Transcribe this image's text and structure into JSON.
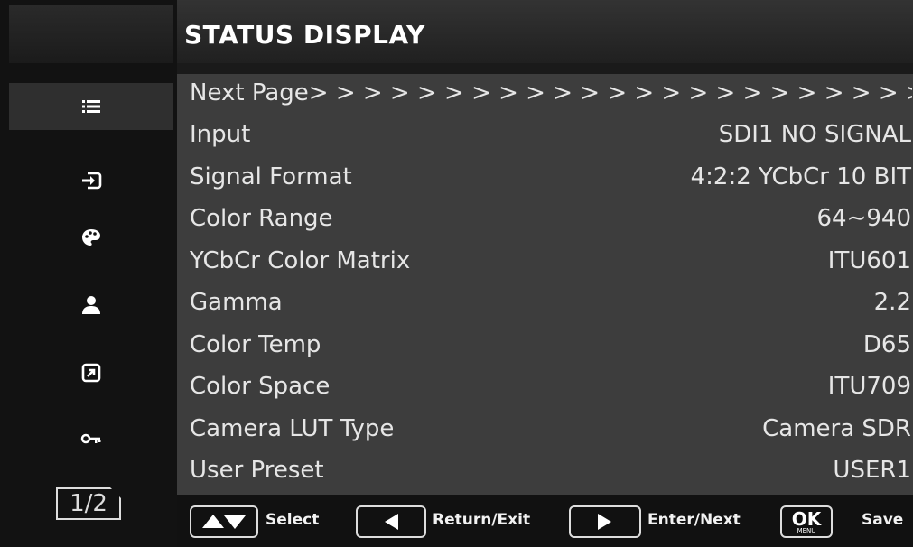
{
  "header": {
    "title": "STATUS DISPLAY"
  },
  "sidebar": {
    "items": [
      {
        "icon": "list-icon",
        "active": true
      },
      {
        "icon": "input-icon",
        "active": false
      },
      {
        "icon": "palette-icon",
        "active": false
      },
      {
        "icon": "user-icon",
        "active": false
      },
      {
        "icon": "shortcut-icon",
        "active": false
      },
      {
        "icon": "key-icon",
        "active": false
      }
    ],
    "page_indicator": "1/2"
  },
  "status": {
    "next_page_label": "Next Page> > > > > > > > > > > > > > > > > > > > > > > >",
    "rows": [
      {
        "label": "Input",
        "value": "SDI1  NO SIGNAL"
      },
      {
        "label": "Signal Format",
        "value": "4:2:2 YCbCr 10 BIT"
      },
      {
        "label": "Color Range",
        "value": "64∼940"
      },
      {
        "label": "YCbCr Color Matrix",
        "value": "ITU601"
      },
      {
        "label": "Gamma",
        "value": "2.2"
      },
      {
        "label": "Color Temp",
        "value": "D65"
      },
      {
        "label": "Color Space",
        "value": "ITU709"
      },
      {
        "label": "Camera LUT Type",
        "value": "Camera SDR"
      },
      {
        "label": "User Preset",
        "value": "USER1"
      }
    ]
  },
  "footer": {
    "select_label": "Select",
    "return_label": "Return/Exit",
    "enter_label": "Enter/Next",
    "ok_label": "OK",
    "menu_label": "MENU",
    "save_label": "Save"
  }
}
